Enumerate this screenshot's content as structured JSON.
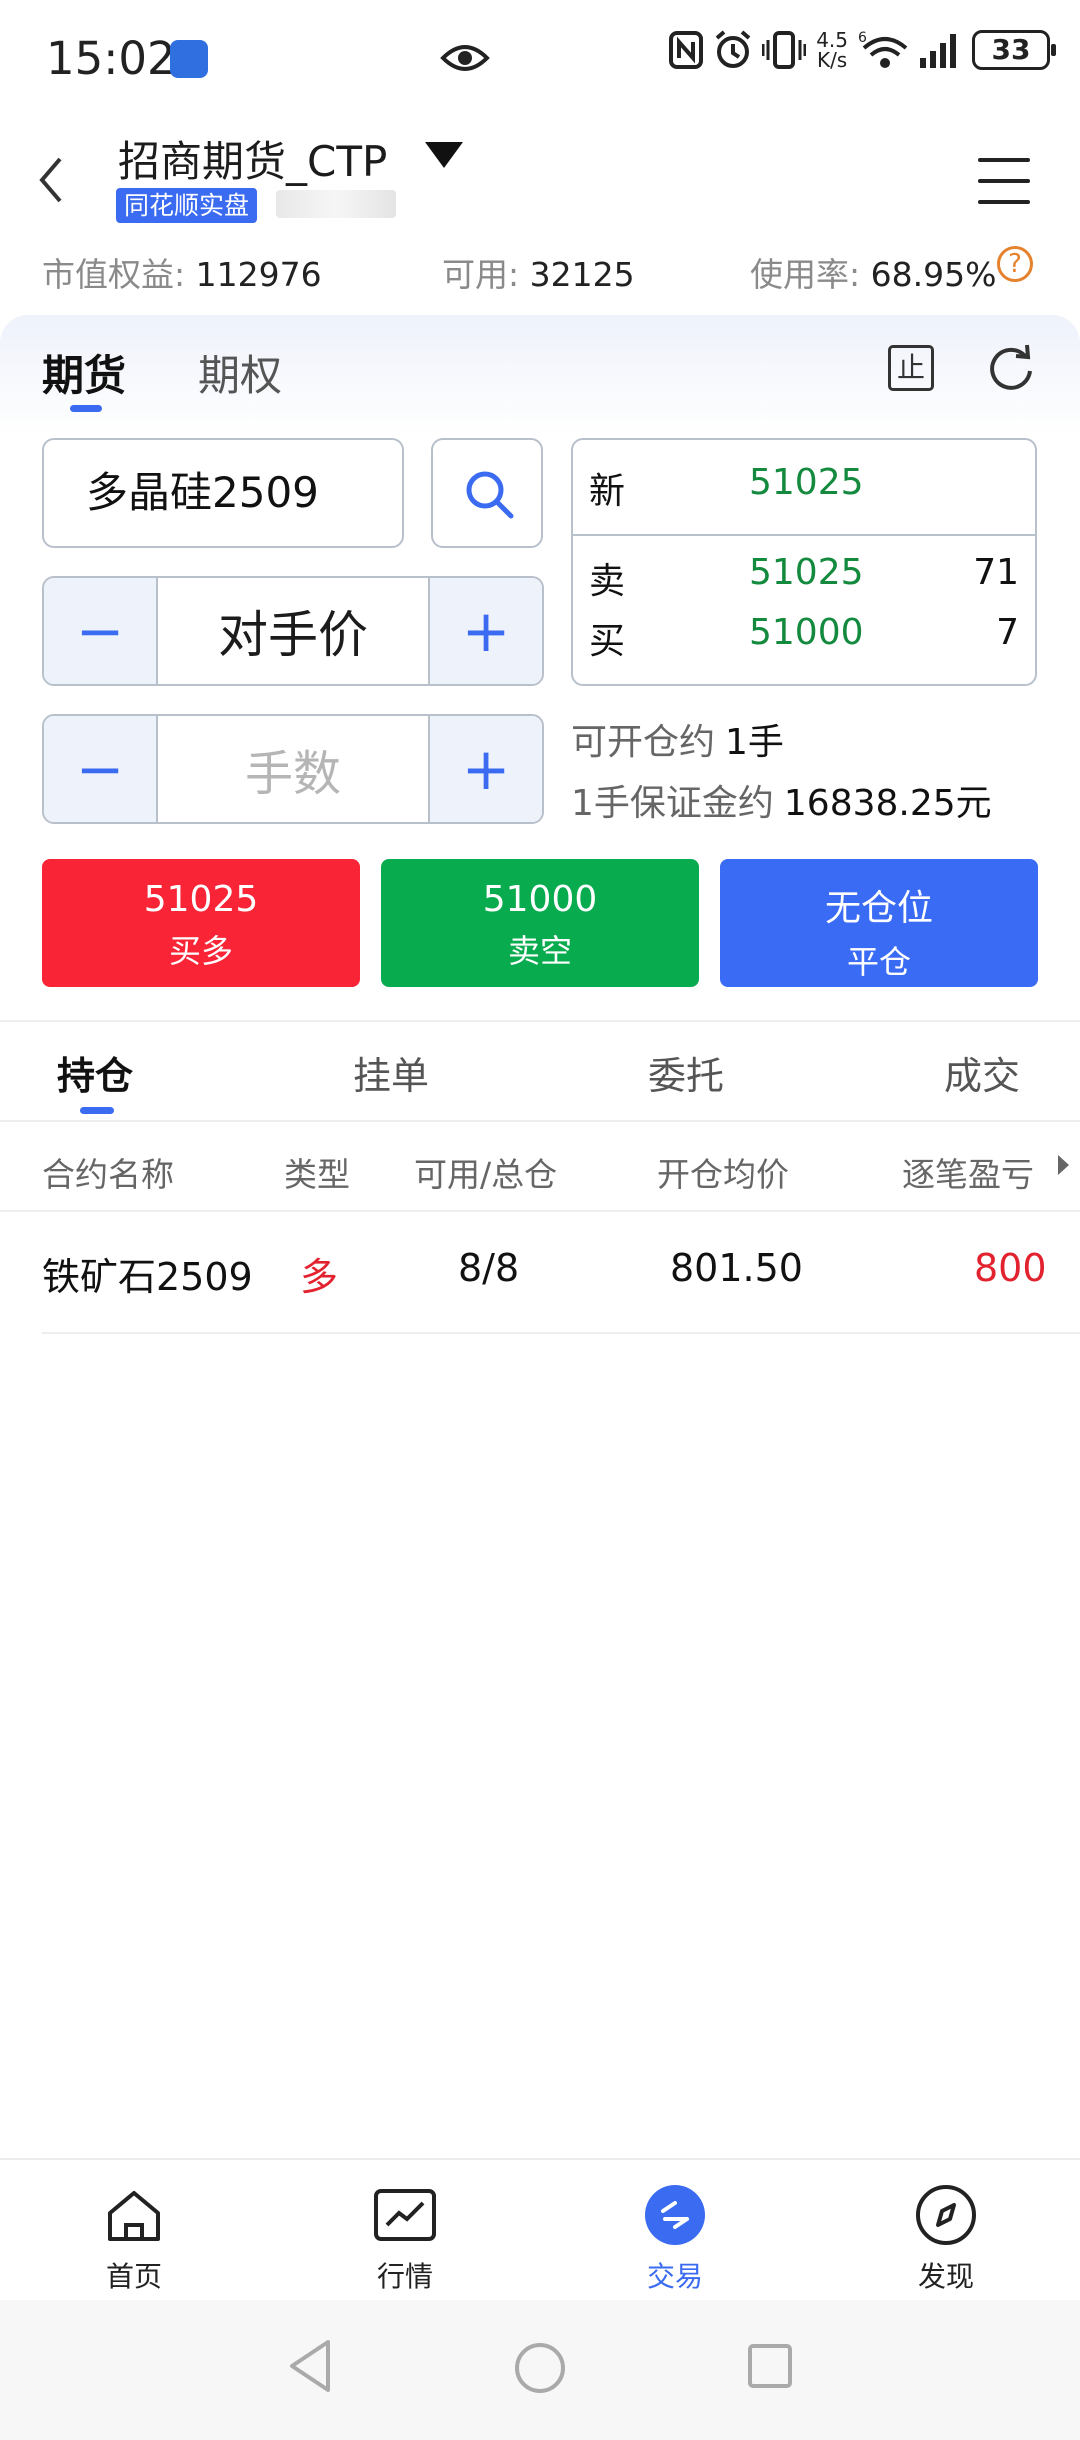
{
  "status": {
    "time": "15:02",
    "speed_top": "4.5",
    "speed_bottom": "K/s",
    "signal_type": "6",
    "battery": "33"
  },
  "header": {
    "broker": "招商期货_CTP",
    "tag": "同花顺实盘",
    "summary": {
      "equity_label": "市值权益:",
      "equity_value": "112976",
      "available_label": "可用:",
      "available_value": "32125",
      "usage_label": "使用率:",
      "usage_value": "68.95%",
      "help": "?"
    }
  },
  "trade": {
    "tabs": [
      "期货",
      "期权"
    ],
    "stop_icon_text": "止",
    "contract": "多晶硅2509",
    "price_type": "对手价",
    "minus": "−",
    "plus": "+",
    "qty_placeholder": "手数",
    "quote": {
      "latest_label": "新",
      "latest_value": "51025",
      "sell_label": "卖",
      "sell_value": "51025",
      "sell_volume": "71",
      "buy_label": "买",
      "buy_value": "51000",
      "buy_volume": "7"
    },
    "openable_label": "可开仓约",
    "openable_value": "1手",
    "margin_label": "1手保证金约",
    "margin_value": "16838.25元",
    "buy_button": {
      "price": "51025",
      "label": "买多"
    },
    "sell_button": {
      "price": "51000",
      "label": "卖空"
    },
    "close_button": {
      "top": "无仓位",
      "label": "平仓"
    }
  },
  "positions": {
    "tabs": [
      "持仓",
      "挂单",
      "委托",
      "成交"
    ],
    "columns": [
      "合约名称",
      "类型",
      "可用/总仓",
      "开仓均价",
      "逐笔盈亏"
    ],
    "rows": [
      {
        "name": "铁矿石2509",
        "type": "多",
        "avail_total": "8/8",
        "avg_price": "801.50",
        "pnl": "800"
      }
    ]
  },
  "nav": {
    "items": [
      {
        "label": "首页",
        "icon": "home-icon"
      },
      {
        "label": "行情",
        "icon": "chart-icon"
      },
      {
        "label": "交易",
        "icon": "trade-icon"
      },
      {
        "label": "发现",
        "icon": "compass-icon"
      }
    ],
    "active": 2
  },
  "colors": {
    "accent": "#3a6bf0",
    "buy": "#fa2437",
    "sell": "#08ab4e",
    "close": "#3a6bf5",
    "quote_green": "#138a3e",
    "loss_red": "#e2232f"
  }
}
